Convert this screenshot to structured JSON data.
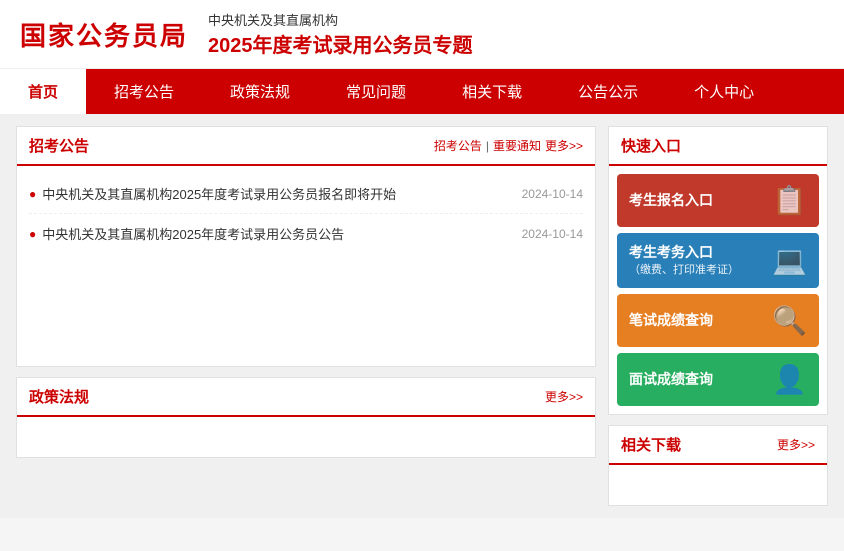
{
  "header": {
    "logo": "国家公务员局",
    "subtitle": "中央机关及其直属机构",
    "title": "2025年度考试录用公务员专题"
  },
  "nav": {
    "items": [
      {
        "label": "首页",
        "active": true
      },
      {
        "label": "招考公告",
        "active": false
      },
      {
        "label": "政策法规",
        "active": false
      },
      {
        "label": "常见问题",
        "active": false
      },
      {
        "label": "相关下载",
        "active": false
      },
      {
        "label": "公告公示",
        "active": false
      },
      {
        "label": "个人中心",
        "active": false
      }
    ]
  },
  "announcements": {
    "title": "招考公告",
    "links": [
      "招考公告",
      "重要通知",
      "更多>>"
    ],
    "items": [
      {
        "text": "中央机关及其直属机构2025年度考试录用公务员报名即将开始",
        "date": "2024-10-14"
      },
      {
        "text": "中央机关及其直属机构2025年度考试录用公务员公告",
        "date": "2024-10-14"
      }
    ]
  },
  "quick_access": {
    "title": "快速入口",
    "buttons": [
      {
        "label": "考生报名入口",
        "sub": "",
        "color": "red",
        "icon": "📋"
      },
      {
        "label": "考生考务入口",
        "sub": "（缴费、打印准考证）",
        "color": "blue",
        "icon": "💻"
      },
      {
        "label": "笔试成绩查询",
        "sub": "",
        "color": "orange",
        "icon": "🔍"
      },
      {
        "label": "面试成绩查询",
        "sub": "",
        "color": "green",
        "icon": "👤"
      }
    ]
  },
  "policy": {
    "title": "政策法规",
    "more": "更多>>"
  },
  "downloads": {
    "title": "相关下载",
    "more": "更多>>"
  }
}
